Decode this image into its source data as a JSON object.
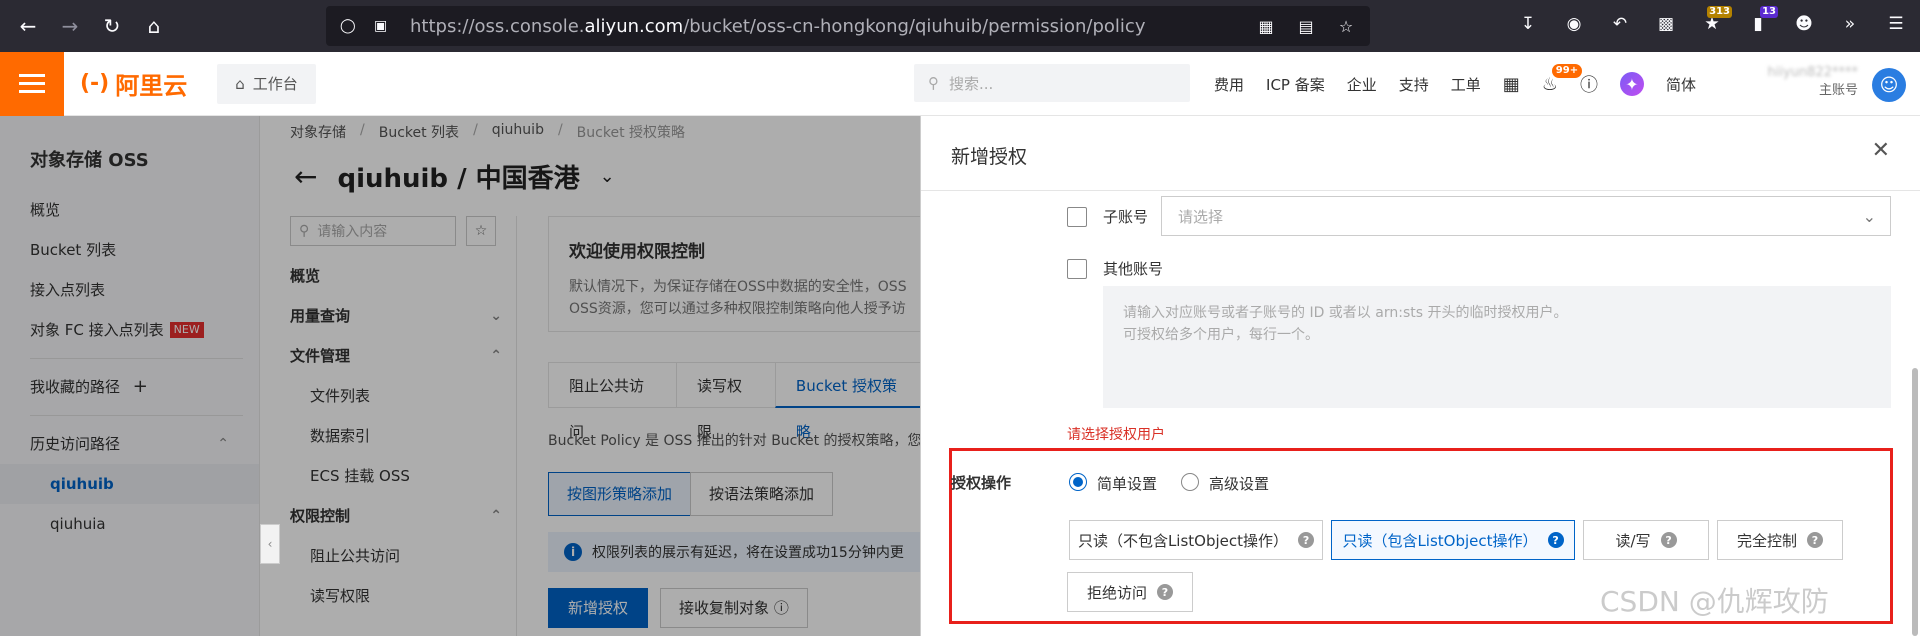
{
  "browser": {
    "url_pre": "https://oss.console.",
    "url_domain": "aliyun.com",
    "url_post": "/bucket/oss-cn-hongkong/qiuhuib/permission/policy",
    "ext_badge_1": "313",
    "ext_badge_2": "13"
  },
  "header": {
    "brand": "阿里云",
    "workbench": "工作台",
    "search_placeholder": "搜索...",
    "links": [
      "费用",
      "ICP 备案",
      "企业",
      "支持",
      "工单"
    ],
    "bell_badge": "99+",
    "lang": "简体",
    "account_role": "主账号",
    "account_name": "hiiyun822****"
  },
  "sidebar": {
    "title": "对象存储 OSS",
    "items": [
      "概览",
      "Bucket 列表",
      "接入点列表",
      "对象 FC 接入点列表"
    ],
    "new_badge": "NEW",
    "favorites": "我收藏的路径",
    "history": "历史访问路径",
    "history_items": [
      "qiuhuib",
      "qiuhuia"
    ]
  },
  "breadcrumb": [
    "对象存储",
    "Bucket 列表",
    "qiuhuib",
    "Bucket 授权策略"
  ],
  "bucket_title": "qiuhuib / 中国香港",
  "subnav": {
    "search_placeholder": "请输入内容",
    "items": [
      {
        "label": "概览"
      },
      {
        "label": "用量查询"
      },
      {
        "label": "文件管理"
      },
      {
        "label": "文件列表"
      },
      {
        "label": "数据索引"
      },
      {
        "label": "ECS 挂载 OSS"
      },
      {
        "label": "权限控制"
      },
      {
        "label": "阻止公共访问"
      },
      {
        "label": "读写权限"
      }
    ]
  },
  "content": {
    "welcome_title": "欢迎使用权限控制",
    "welcome_line1": "默认情况下，为保证存储在OSS中数据的安全性，OSS",
    "welcome_line2": "OSS资源，您可以通过多种权限控制策略向他人授予访",
    "tabs": [
      "阻止公共访问",
      "读写权限",
      "Bucket 授权策略"
    ],
    "policy_desc": "Bucket Policy 是 OSS 推出的针对 Bucket 的授权策略，您",
    "mode_buttons": [
      "按图形策略添加",
      "按语法策略添加"
    ],
    "info_text": "权限列表的展示有延迟，将在设置成功15分钟内更",
    "add_button": "新增授权",
    "copy_button": "接收复制对象"
  },
  "drawer": {
    "title": "新增授权",
    "sub_account_label": "子账号",
    "sub_account_placeholder": "请选择",
    "other_account_label": "其他账号",
    "textarea_line1": "请输入对应账号或者子账号的 ID 或者以 arn:sts 开头的临时授权用户。",
    "textarea_line2": "可授权给多个用户，每行一个。",
    "error_text": "请选择授权用户",
    "perm_label": "授权操作",
    "radio_simple": "简单设置",
    "radio_advanced": "高级设置",
    "options": [
      "只读（不包含ListObject操作）",
      "只读（包含ListObject操作）",
      "读/写",
      "完全控制",
      "拒绝访问"
    ]
  },
  "watermark": "CSDN @仇辉攻防",
  "colors": {
    "brand": "#ff6a00",
    "primary": "#0064c8",
    "error": "#d93026",
    "highlight_box": "#e8201b"
  }
}
